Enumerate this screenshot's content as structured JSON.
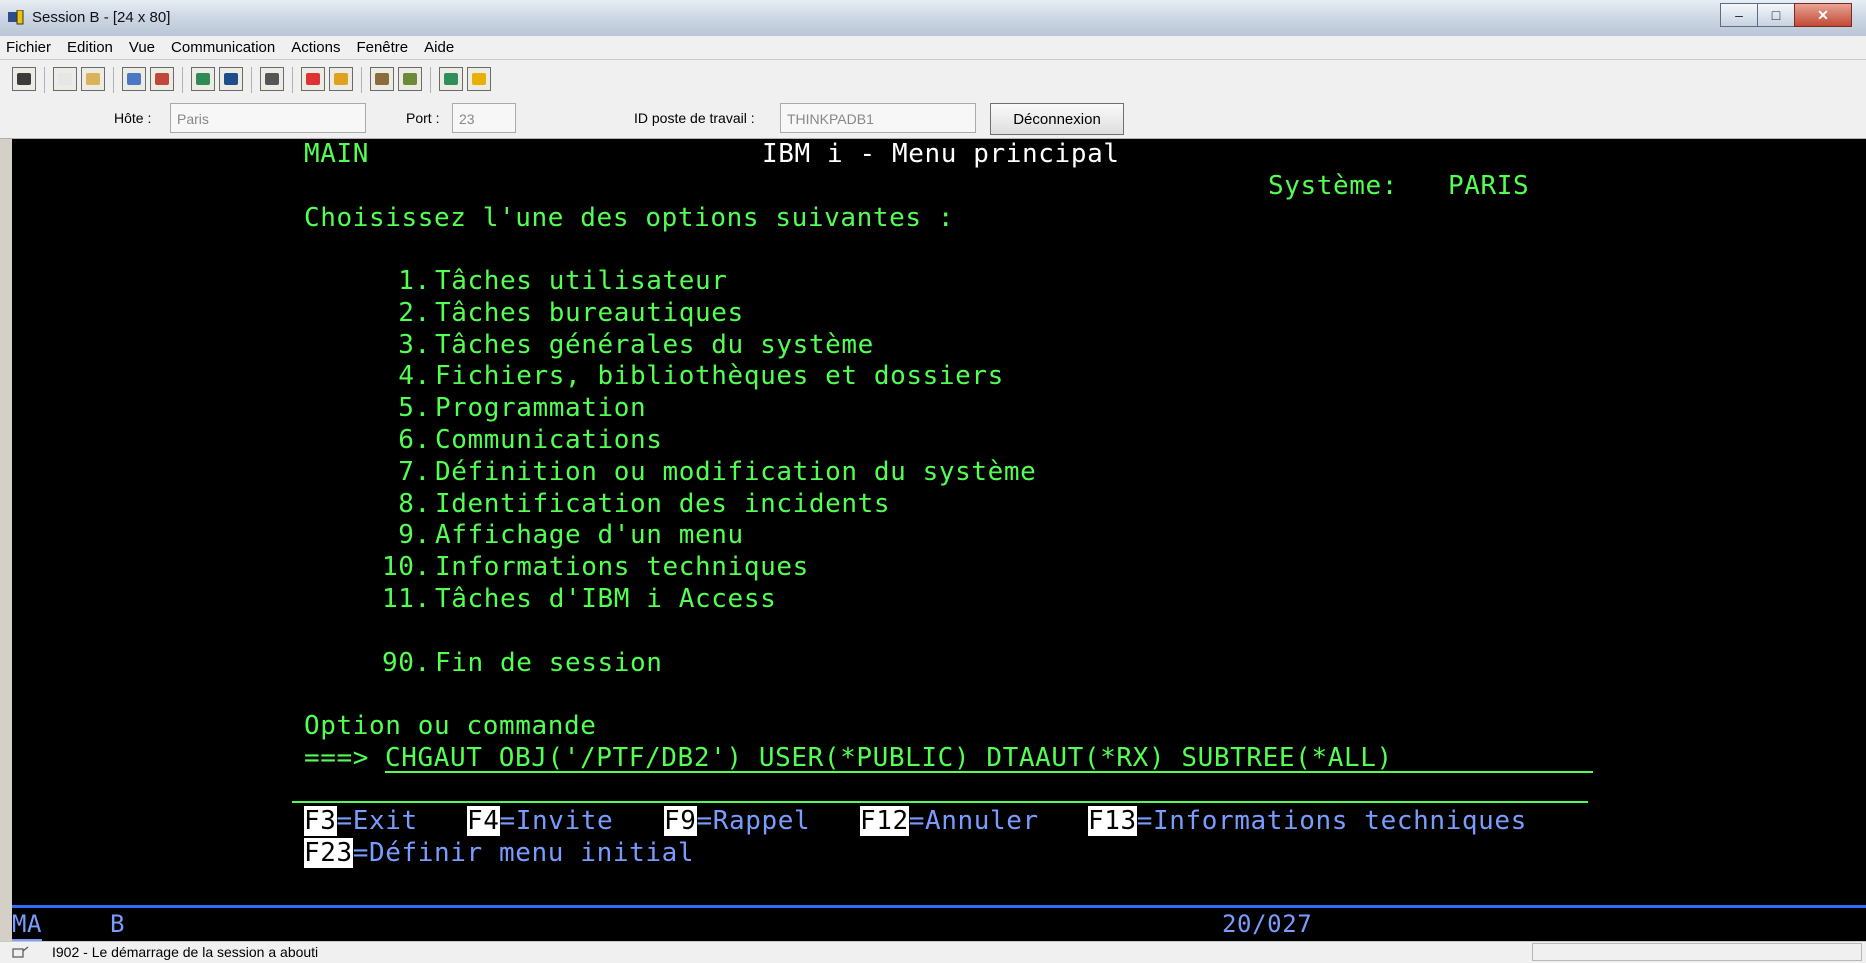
{
  "window": {
    "title": "Session B - [24 x 80]",
    "buttons": [
      "minimize-icon",
      "maximize-icon",
      "close-icon"
    ]
  },
  "menu": [
    "Fichier",
    "Edition",
    "Vue",
    "Communication",
    "Actions",
    "Fenêtre",
    "Aide"
  ],
  "toolbar": {
    "icons": [
      "print-screen-icon",
      "copy-icon",
      "paste-icon",
      "send-icon",
      "receive-icon",
      "display-icon",
      "keyboard-icon",
      "macro-icon",
      "record-icon",
      "play-icon",
      "transfer-send-icon",
      "transfer-receive-icon",
      "globe-icon",
      "help-icon"
    ]
  },
  "connection": {
    "host_label": "Hôte :",
    "host_value": "Paris",
    "port_label": "Port :",
    "port_value": "23",
    "workstation_label": "ID poste de travail :",
    "workstation_value": "THINKPADB1",
    "disconnect_label": "Déconnexion"
  },
  "screen": {
    "menu_id": "MAIN",
    "title": "IBM i - Menu principal",
    "system_label": "Système:",
    "system_value": "PARIS",
    "prompt": "Choisissez l'une des options suivantes :",
    "options": [
      {
        "num": " 1.",
        "label": "Tâches utilisateur"
      },
      {
        "num": " 2.",
        "label": "Tâches bureautiques"
      },
      {
        "num": " 3.",
        "label": "Tâches générales du système"
      },
      {
        "num": " 4.",
        "label": "Fichiers, bibliothèques et dossiers"
      },
      {
        "num": " 5.",
        "label": "Programmation"
      },
      {
        "num": " 6.",
        "label": "Communications"
      },
      {
        "num": " 7.",
        "label": "Définition ou modification du système"
      },
      {
        "num": " 8.",
        "label": "Identification des incidents"
      },
      {
        "num": " 9.",
        "label": "Affichage d'un menu"
      },
      {
        "num": "10.",
        "label": "Informations techniques"
      },
      {
        "num": "11.",
        "label": "Tâches d'IBM i Access"
      }
    ],
    "signoff": {
      "num": "90.",
      "label": "Fin de session"
    },
    "command_label": "Option ou commande",
    "command_arrow": "===>",
    "command_value": "CHGAUT OBJ('/PTF/DB2') USER(*PUBLIC) DTAAUT(*RX) SUBTREE(*ALL)",
    "fkeys_row1": [
      {
        "key": "F3",
        "label": "=Exit"
      },
      {
        "key": "F4",
        "label": "=Invite"
      },
      {
        "key": "F9",
        "label": "=Rappel"
      },
      {
        "key": "F12",
        "label": "=Annuler"
      },
      {
        "key": "F13",
        "label": "=Informations techniques"
      }
    ],
    "fkeys_row2": [
      {
        "key": "F23",
        "label": "=Définir menu initial"
      }
    ]
  },
  "oia": {
    "mode": "MA",
    "session": "B",
    "cursor": "20/027"
  },
  "status": {
    "message": "I902 - Le démarrage de la session a abouti"
  },
  "colors": {
    "screen_bg": "#000000",
    "field_green": "#52ff52",
    "title_white": "#ffffff",
    "fkey_blue": "#7b9cff"
  }
}
